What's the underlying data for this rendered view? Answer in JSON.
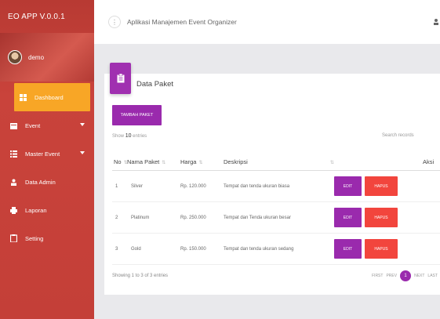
{
  "brand": "EO  APP V.0.0.1",
  "user": {
    "name": "demo"
  },
  "sidebar": {
    "items": [
      {
        "label": "Dashboard",
        "icon": "dashboard-icon",
        "active": true
      },
      {
        "label": "Event",
        "icon": "event-icon",
        "has_caret": true
      },
      {
        "label": "Master Event",
        "icon": "list-icon",
        "has_caret": true
      },
      {
        "label": "Data Admin",
        "icon": "person-icon"
      },
      {
        "label": "Laporan",
        "icon": "print-icon"
      },
      {
        "label": "Setting",
        "icon": "clipboard-icon"
      }
    ]
  },
  "topbar": {
    "menu_icon": "⋮",
    "title": "Aplikasi Manajemen Event Organizer"
  },
  "card": {
    "title": "Data Paket",
    "add_button": "TAMBAH PAKET",
    "show_prefix": "Show",
    "show_value": "10",
    "show_suffix": "entries",
    "search_placeholder": "Search records"
  },
  "table": {
    "headers": [
      "No",
      "Nama Paket",
      "Harga",
      "Deskripsi",
      "Aksi"
    ],
    "rows": [
      {
        "no": "1",
        "nama": "Silver",
        "harga": "Rp. 120.000",
        "deskripsi": "Tempat dan tenda ukuran biasa"
      },
      {
        "no": "2",
        "nama": "Platinum",
        "harga": "Rp. 250.000",
        "deskripsi": "Tempat dan Tenda ukuran besar"
      },
      {
        "no": "3",
        "nama": "Gold",
        "harga": "Rp. 150.000",
        "deskripsi": "Tempat dan tenda ukuran sedang"
      }
    ],
    "edit_label": "EDIT",
    "delete_label": "HAPUS"
  },
  "footer": {
    "info": "Showing 1 to 3 of 3 entries",
    "first": "FIRST",
    "prev": "PREV",
    "page": "1",
    "next": "NEXT",
    "last": "LAST"
  },
  "colors": {
    "sidebar": "#c43f38",
    "active": "#f8a626",
    "primary": "#9a2aad",
    "danger": "#f2453d"
  }
}
